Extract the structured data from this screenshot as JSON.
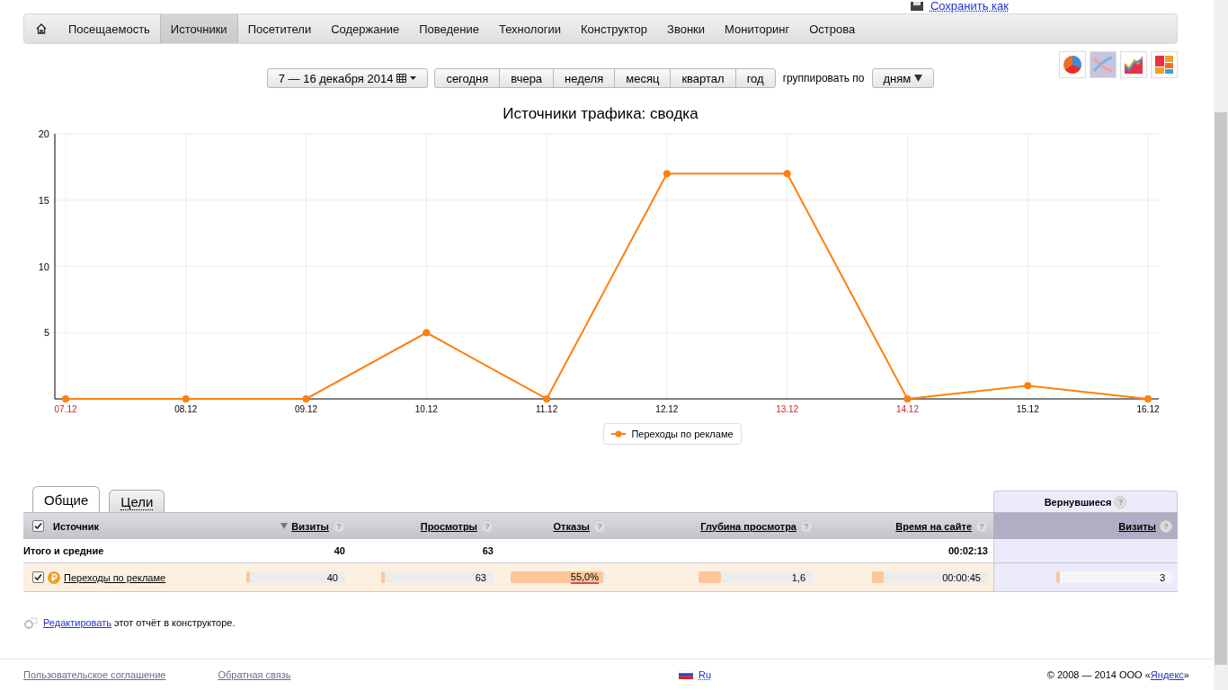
{
  "save_link": "Сохранить как",
  "nav": [
    {
      "kind": "home",
      "selected": false
    },
    {
      "kind": "item",
      "label": "Посещаемость",
      "selected": false
    },
    {
      "kind": "item",
      "label": "Источники",
      "selected": true
    },
    {
      "kind": "item",
      "label": "Посетители",
      "selected": false
    },
    {
      "kind": "item",
      "label": "Содержание",
      "selected": false
    },
    {
      "kind": "item",
      "label": "Поведение",
      "selected": false
    },
    {
      "kind": "item",
      "label": "Технологии",
      "selected": false
    },
    {
      "kind": "item",
      "label": "Конструктор",
      "selected": false
    },
    {
      "kind": "item",
      "label": "Звонки",
      "selected": false
    },
    {
      "kind": "item",
      "label": "Мониторинг",
      "selected": false
    },
    {
      "kind": "item",
      "label": "Острова",
      "selected": false
    }
  ],
  "date_range": "7 — 16 декабря 2014",
  "periods": [
    "сегодня",
    "вчера",
    "неделя",
    "месяц",
    "квартал",
    "год"
  ],
  "group_by": {
    "label": "группировать по",
    "value": "дням"
  },
  "chart_types": [
    {
      "kind": "pie",
      "selected": false
    },
    {
      "kind": "lines",
      "selected": true
    },
    {
      "kind": "area",
      "selected": false
    },
    {
      "kind": "blocks",
      "selected": false
    }
  ],
  "chart": {
    "weekend": [
      true,
      false,
      false,
      false,
      false,
      false,
      true,
      true,
      false,
      false
    ],
    "chart_data": {
      "type": "line",
      "title": "Источники трафика: сводка",
      "categories": [
        "07.12",
        "08.12",
        "09.12",
        "10.12",
        "11.12",
        "12.12",
        "13.12",
        "14.12",
        "15.12",
        "16.12"
      ],
      "series": [
        {
          "name": "Переходы по рекламе",
          "color": "#ff7f0e",
          "marker": "circle",
          "values": [
            0,
            0,
            0,
            5,
            0,
            17,
            17,
            0,
            1,
            0
          ]
        }
      ],
      "ylim": [
        0,
        20
      ],
      "yticks": [
        5,
        10,
        15,
        20
      ],
      "grid": true
    }
  },
  "tabs": [
    {
      "label": "Общие",
      "selected": true
    },
    {
      "label": "Цели",
      "selected": false
    }
  ],
  "table": {
    "returning_group": {
      "label": "Вернувшиеся",
      "help": "?"
    },
    "columns": [
      {
        "label": "Источник",
        "checked": true
      },
      {
        "label": "Визиты",
        "help": "?",
        "sorted": true
      },
      {
        "label": "Просмотры",
        "help": "?",
        "sorted": false
      },
      {
        "label": "Отказы",
        "help": "?",
        "sorted": false
      },
      {
        "label": "Глубина просмотра",
        "help": "?",
        "sorted": false
      },
      {
        "label": "Время на сайте",
        "help": "?",
        "sorted": false
      },
      {
        "label": "Визиты",
        "help": "?",
        "sorted": false
      }
    ],
    "total": {
      "cells": [
        "Итого и средние",
        "40",
        "63",
        "",
        "",
        "00:02:13",
        ""
      ]
    },
    "rows": [
      {
        "checked": true,
        "cells": [
          {
            "value": "Переходы по рекламе"
          },
          {
            "value": "40",
            "level": 0.04
          },
          {
            "value": "63",
            "level": 0.03
          },
          {
            "value": "55,0%",
            "level": 0.97
          },
          {
            "value": "1,6",
            "level": 0.2
          },
          {
            "value": "00:00:45",
            "level": 0.1
          },
          {
            "value": "3",
            "level": 0.03
          }
        ]
      }
    ]
  },
  "edit_note": {
    "link": "Редактировать",
    "text": " этот отчёт в конструкторе."
  },
  "footer": {
    "links": [
      "Пользовательское соглашение",
      "Обратная связь"
    ],
    "language": "Ru",
    "copyright": "© 2008 — 2014 ООО «",
    "company_link": "Яндекс",
    "copyright_end": "»"
  }
}
